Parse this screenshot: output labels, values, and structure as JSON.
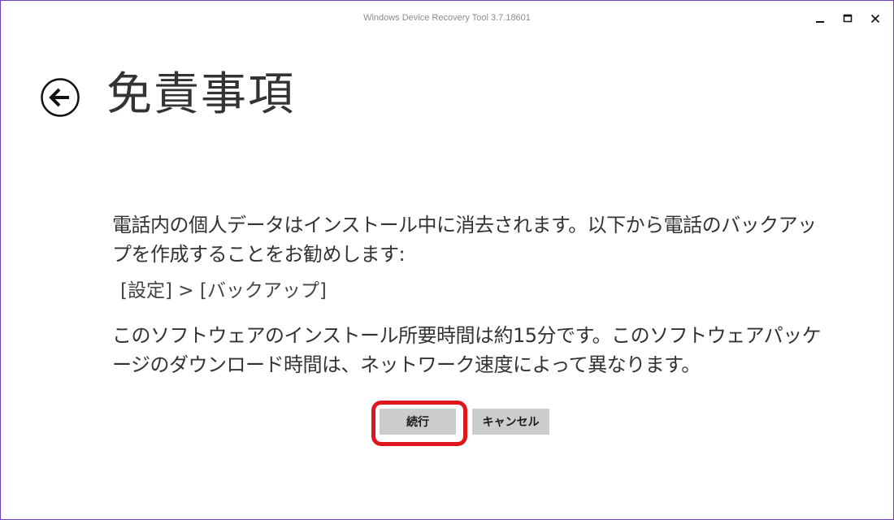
{
  "window": {
    "title": "Windows Device Recovery Tool 3.7.18601"
  },
  "header": {
    "title": "免責事項"
  },
  "body": {
    "paragraph1": "電話内の個人データはインストール中に消去されます。以下から電話のバックアップを作成することをお勧めします:",
    "path": "[設定] > [バックアップ]",
    "paragraph2": "このソフトウェアのインストール所要時間は約15分です。このソフトウェアパッケージのダウンロード時間は、ネットワーク速度によって異なります。"
  },
  "actions": {
    "continue_label": "続行",
    "cancel_label": "キャンセル"
  },
  "icons": {
    "back": "back-arrow-circle-icon",
    "minimize": "minimize-icon",
    "maximize": "maximize-icon",
    "close": "close-icon"
  },
  "colors": {
    "highlight": "#e0161f",
    "button_bg": "#cccccc",
    "border": "#6b3fb8"
  }
}
